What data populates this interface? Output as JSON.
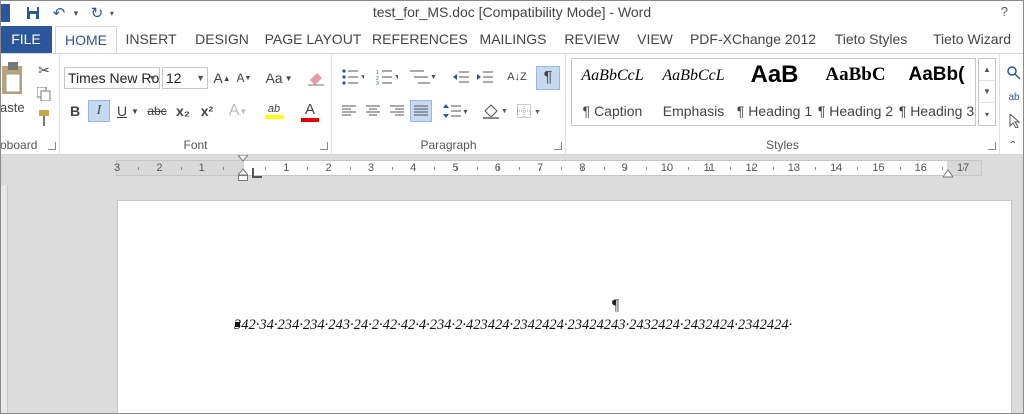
{
  "window": {
    "title": "test_for_MS.doc [Compatibility Mode] - Word",
    "help": "?"
  },
  "quick_access": {
    "save_icon": "floppy-disk-icon",
    "undo_icon": "undo-icon",
    "redo_icon": "redo-icon",
    "customize_icon": "chevron-down-icon"
  },
  "tabs": [
    {
      "label": "FILE"
    },
    {
      "label": "HOME"
    },
    {
      "label": "INSERT"
    },
    {
      "label": "DESIGN"
    },
    {
      "label": "PAGE LAYOUT"
    },
    {
      "label": "REFERENCES"
    },
    {
      "label": "MAILINGS"
    },
    {
      "label": "REVIEW"
    },
    {
      "label": "VIEW"
    },
    {
      "label": "PDF-XChange 2012"
    },
    {
      "label": "Tieto Styles"
    },
    {
      "label": "Tieto Wizard"
    }
  ],
  "active_tab": "HOME",
  "ribbon": {
    "clipboard": {
      "label": "oboard",
      "paste_label": "aste"
    },
    "font": {
      "label": "Font",
      "font_name": "Times New Ro",
      "font_size": "12",
      "grow": "A",
      "shrink": "A",
      "case": "Aa",
      "bold": "B",
      "italic": "I",
      "underline": "U",
      "strike": "abc",
      "subscript": "x₂",
      "superscript": "x²",
      "effects": "A",
      "highlight": "ab",
      "font_color": "A",
      "highlight_color": "#ffff00",
      "font_color_value": "#e00000"
    },
    "paragraph": {
      "label": "Paragraph",
      "show_marks": "¶",
      "sort": "A↓Z"
    },
    "styles": {
      "label": "Styles",
      "items": [
        {
          "sample": "AaBbCcL",
          "name": "¶ Caption"
        },
        {
          "sample": "AaBbCcL",
          "name": "Emphasis"
        },
        {
          "sample": "AaB",
          "name": "¶ Heading 1"
        },
        {
          "sample": "AaBbC",
          "name": "¶ Heading 2"
        },
        {
          "sample": "AaBb(",
          "name": "¶ Heading 3"
        }
      ]
    }
  },
  "ruler": {
    "numbers": [
      "3",
      "2",
      "1",
      "1",
      "2",
      "3",
      "4",
      "5",
      "6",
      "7",
      "8",
      "9",
      "10",
      "11",
      "12",
      "13",
      "14",
      "15",
      "16",
      "17"
    ]
  },
  "document": {
    "pilcrow": "¶",
    "line": "342·34·234·234·243·24·2·42·42·4·234·2·423424·2342424·23424243·2432424·2432424·2342424·"
  }
}
